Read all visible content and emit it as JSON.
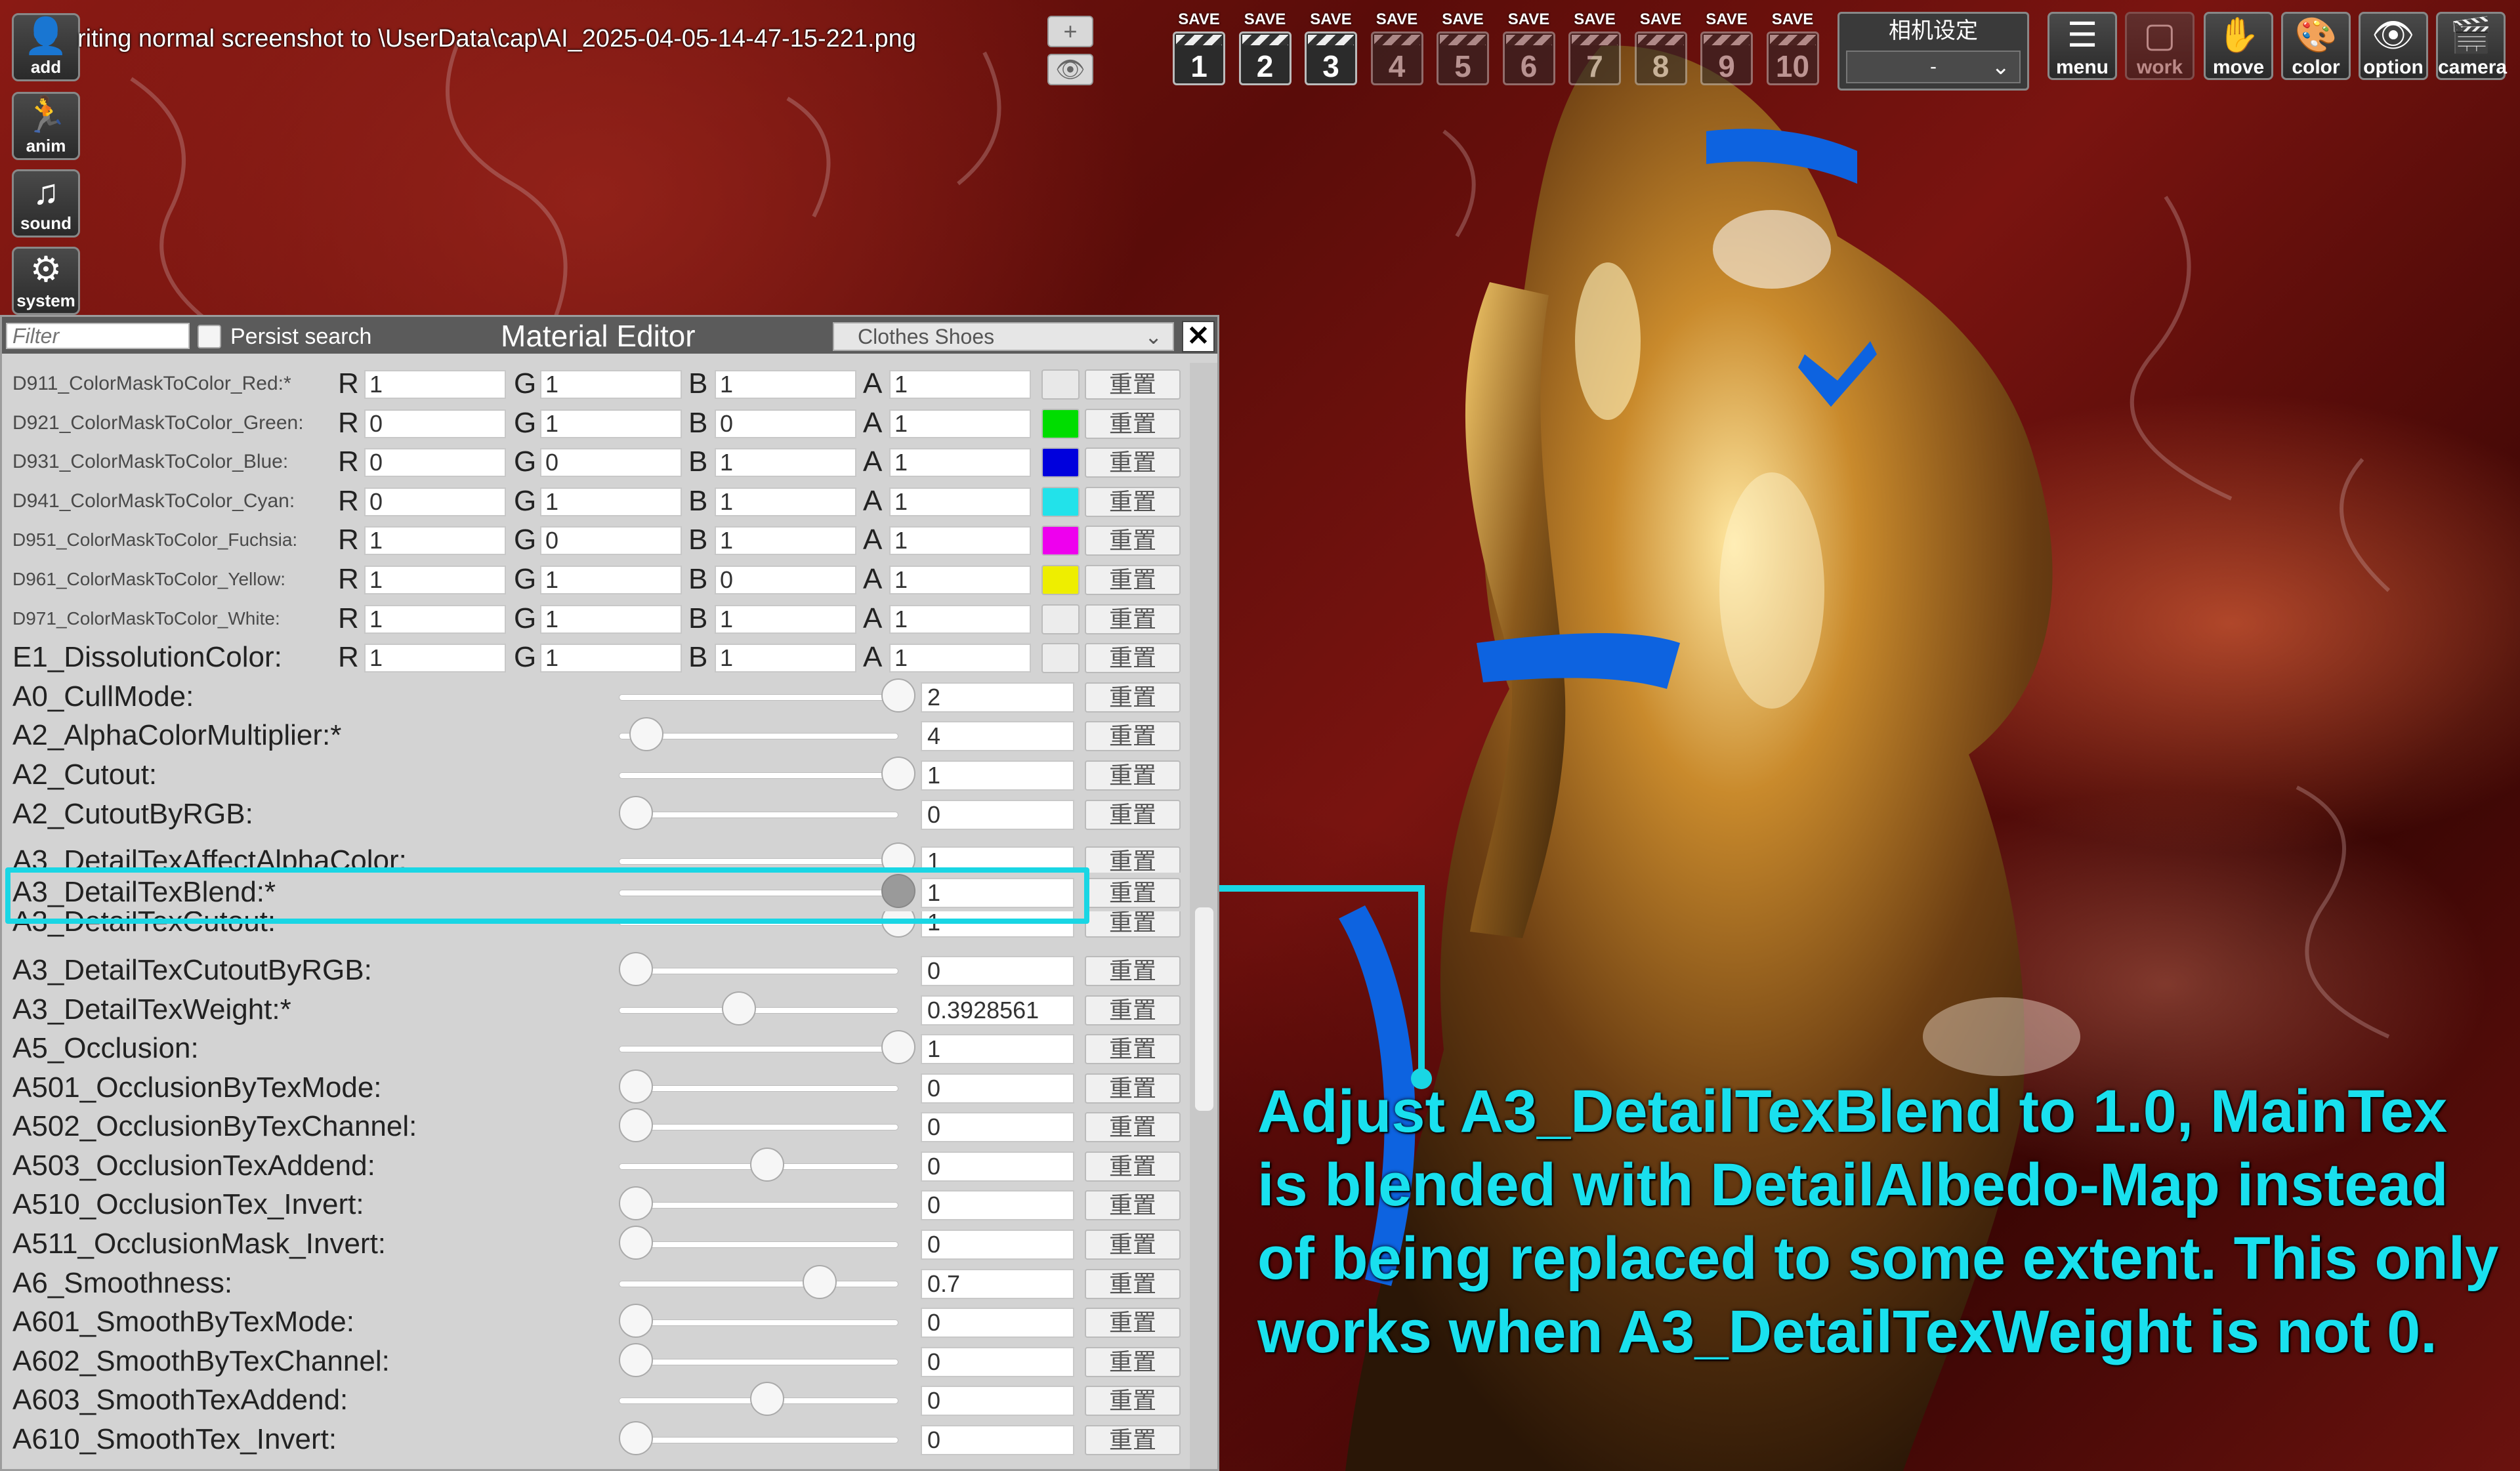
{
  "status_text": "riting normal screenshot to \\UserData\\cap\\AI_2025-04-05-14-47-15-221.png",
  "left_tools": [
    {
      "label": "add",
      "icon": "person-add-icon",
      "glyph": "👤"
    },
    {
      "label": "anim",
      "icon": "running-person-icon",
      "glyph": "🏃"
    },
    {
      "label": "sound",
      "icon": "music-note-icon",
      "glyph": "♫"
    },
    {
      "label": "system",
      "icon": "gears-icon",
      "glyph": "⚙"
    }
  ],
  "mini_buttons": [
    {
      "label": "+",
      "icon": "plus-icon"
    },
    {
      "label": "👁",
      "icon": "eye-icon"
    }
  ],
  "save_slots": [
    {
      "label": "SAVE",
      "number": "1"
    },
    {
      "label": "SAVE",
      "number": "2"
    },
    {
      "label": "SAVE",
      "number": "3"
    },
    {
      "label": "SAVE",
      "number": "4"
    },
    {
      "label": "SAVE",
      "number": "5"
    },
    {
      "label": "SAVE",
      "number": "6"
    },
    {
      "label": "SAVE",
      "number": "7"
    },
    {
      "label": "SAVE",
      "number": "8"
    },
    {
      "label": "SAVE",
      "number": "9"
    },
    {
      "label": "SAVE",
      "number": "10"
    }
  ],
  "camera_setting": {
    "title": "相机设定",
    "value": "-"
  },
  "top_tools": [
    {
      "label": "menu",
      "icon": "menu-list-icon",
      "glyph": "☰"
    },
    {
      "label": "work",
      "icon": "work-frame-icon",
      "glyph": "▢"
    },
    {
      "label": "move",
      "icon": "hand-icon",
      "glyph": "✋"
    },
    {
      "label": "color",
      "icon": "palette-icon",
      "glyph": "🎨"
    },
    {
      "label": "option",
      "icon": "eye-icon",
      "glyph": "👁"
    },
    {
      "label": "camera",
      "icon": "clapper-icon",
      "glyph": "🎬"
    }
  ],
  "editor": {
    "filter_placeholder": "Filter",
    "persist_label": "Persist search",
    "title": "Material Editor",
    "category": "Clothes Shoes",
    "close": "✕",
    "reset_label": "重置"
  },
  "color_rows": [
    {
      "name": "D911_ColorMaskToColor_Red:*",
      "r": "1",
      "g": "1",
      "b": "1",
      "a": "1",
      "swatch": "#e8e8e8",
      "size": "small"
    },
    {
      "name": "D921_ColorMaskToColor_Green:",
      "r": "0",
      "g": "1",
      "b": "0",
      "a": "1",
      "swatch": "#00dd00",
      "size": "small"
    },
    {
      "name": "D931_ColorMaskToColor_Blue:",
      "r": "0",
      "g": "0",
      "b": "1",
      "a": "1",
      "swatch": "#0000dd",
      "size": "small"
    },
    {
      "name": "D941_ColorMaskToColor_Cyan:",
      "r": "0",
      "g": "1",
      "b": "1",
      "a": "1",
      "swatch": "#22e2ea",
      "size": "small"
    },
    {
      "name": "D951_ColorMaskToColor_Fuchsia:",
      "r": "1",
      "g": "0",
      "b": "1",
      "a": "1",
      "swatch": "#ee00ee",
      "size": "tiny"
    },
    {
      "name": "D961_ColorMaskToColor_Yellow:",
      "r": "1",
      "g": "1",
      "b": "0",
      "a": "1",
      "swatch": "#eeee00",
      "size": "tiny"
    },
    {
      "name": "D971_ColorMaskToColor_White:",
      "r": "1",
      "g": "1",
      "b": "1",
      "a": "1",
      "swatch": "#ececec",
      "size": "tiny"
    },
    {
      "name": "E1_DissolutionColor:",
      "r": "1",
      "g": "1",
      "b": "1",
      "a": "1",
      "swatch": "#ececec",
      "size": "normal"
    }
  ],
  "channel_labels": {
    "r": "R",
    "g": "G",
    "b": "B",
    "a": "A"
  },
  "slider_rows": [
    {
      "name": "A0_CullMode:",
      "value": "2",
      "fraction": 1.0
    },
    {
      "name": "A2_AlphaColorMultiplier:*",
      "value": "4",
      "fraction": 0.04
    },
    {
      "name": "A2_Cutout:",
      "value": "1",
      "fraction": 1.0
    },
    {
      "name": "A2_CutoutByRGB:",
      "value": "0",
      "fraction": 0.0
    },
    {
      "name": "A3_DetailTexAffectAlphaColor:",
      "value": "1",
      "fraction": 1.0,
      "clip": "bottom"
    },
    {
      "name": "A3_DetailTexBlend:*",
      "value": "1",
      "fraction": 1.0,
      "highlight": true
    },
    {
      "name": "A3_DetailTexCutout:",
      "value": "1",
      "fraction": 1.0,
      "clip": "top"
    },
    {
      "name": "A3_DetailTexCutoutByRGB:",
      "value": "0",
      "fraction": 0.0
    },
    {
      "name": "A3_DetailTexWeight:*",
      "value": "0.3928561",
      "fraction": 0.3928561
    },
    {
      "name": "A5_Occlusion:",
      "value": "1",
      "fraction": 1.0
    },
    {
      "name": "A501_OcclusionByTexMode:",
      "value": "0",
      "fraction": 0.0
    },
    {
      "name": "A502_OcclusionByTexChannel:",
      "value": "0",
      "fraction": 0.0
    },
    {
      "name": "A503_OcclusionTexAddend:",
      "value": "0",
      "fraction": 0.5
    },
    {
      "name": "A510_OcclusionTex_Invert:",
      "value": "0",
      "fraction": 0.0
    },
    {
      "name": "A511_OcclusionMask_Invert:",
      "value": "0",
      "fraction": 0.0
    },
    {
      "name": "A6_Smoothness:",
      "value": "0.7",
      "fraction": 0.7
    },
    {
      "name": "A601_SmoothByTexMode:",
      "value": "0",
      "fraction": 0.0
    },
    {
      "name": "A602_SmoothByTexChannel:",
      "value": "0",
      "fraction": 0.0
    },
    {
      "name": "A603_SmoothTexAddend:",
      "value": "0",
      "fraction": 0.5
    },
    {
      "name": "A610_SmoothTex_Invert:",
      "value": "0",
      "fraction": 0.0
    }
  ],
  "annotation": {
    "text": "Adjust A3_DetailTexBlend to 1.0, MainTex is blended with DetailAlbedo-Map instead of being replaced to some extent. This only works when A3_DetailTexWeight is not 0.",
    "color": "#19e0ee"
  }
}
